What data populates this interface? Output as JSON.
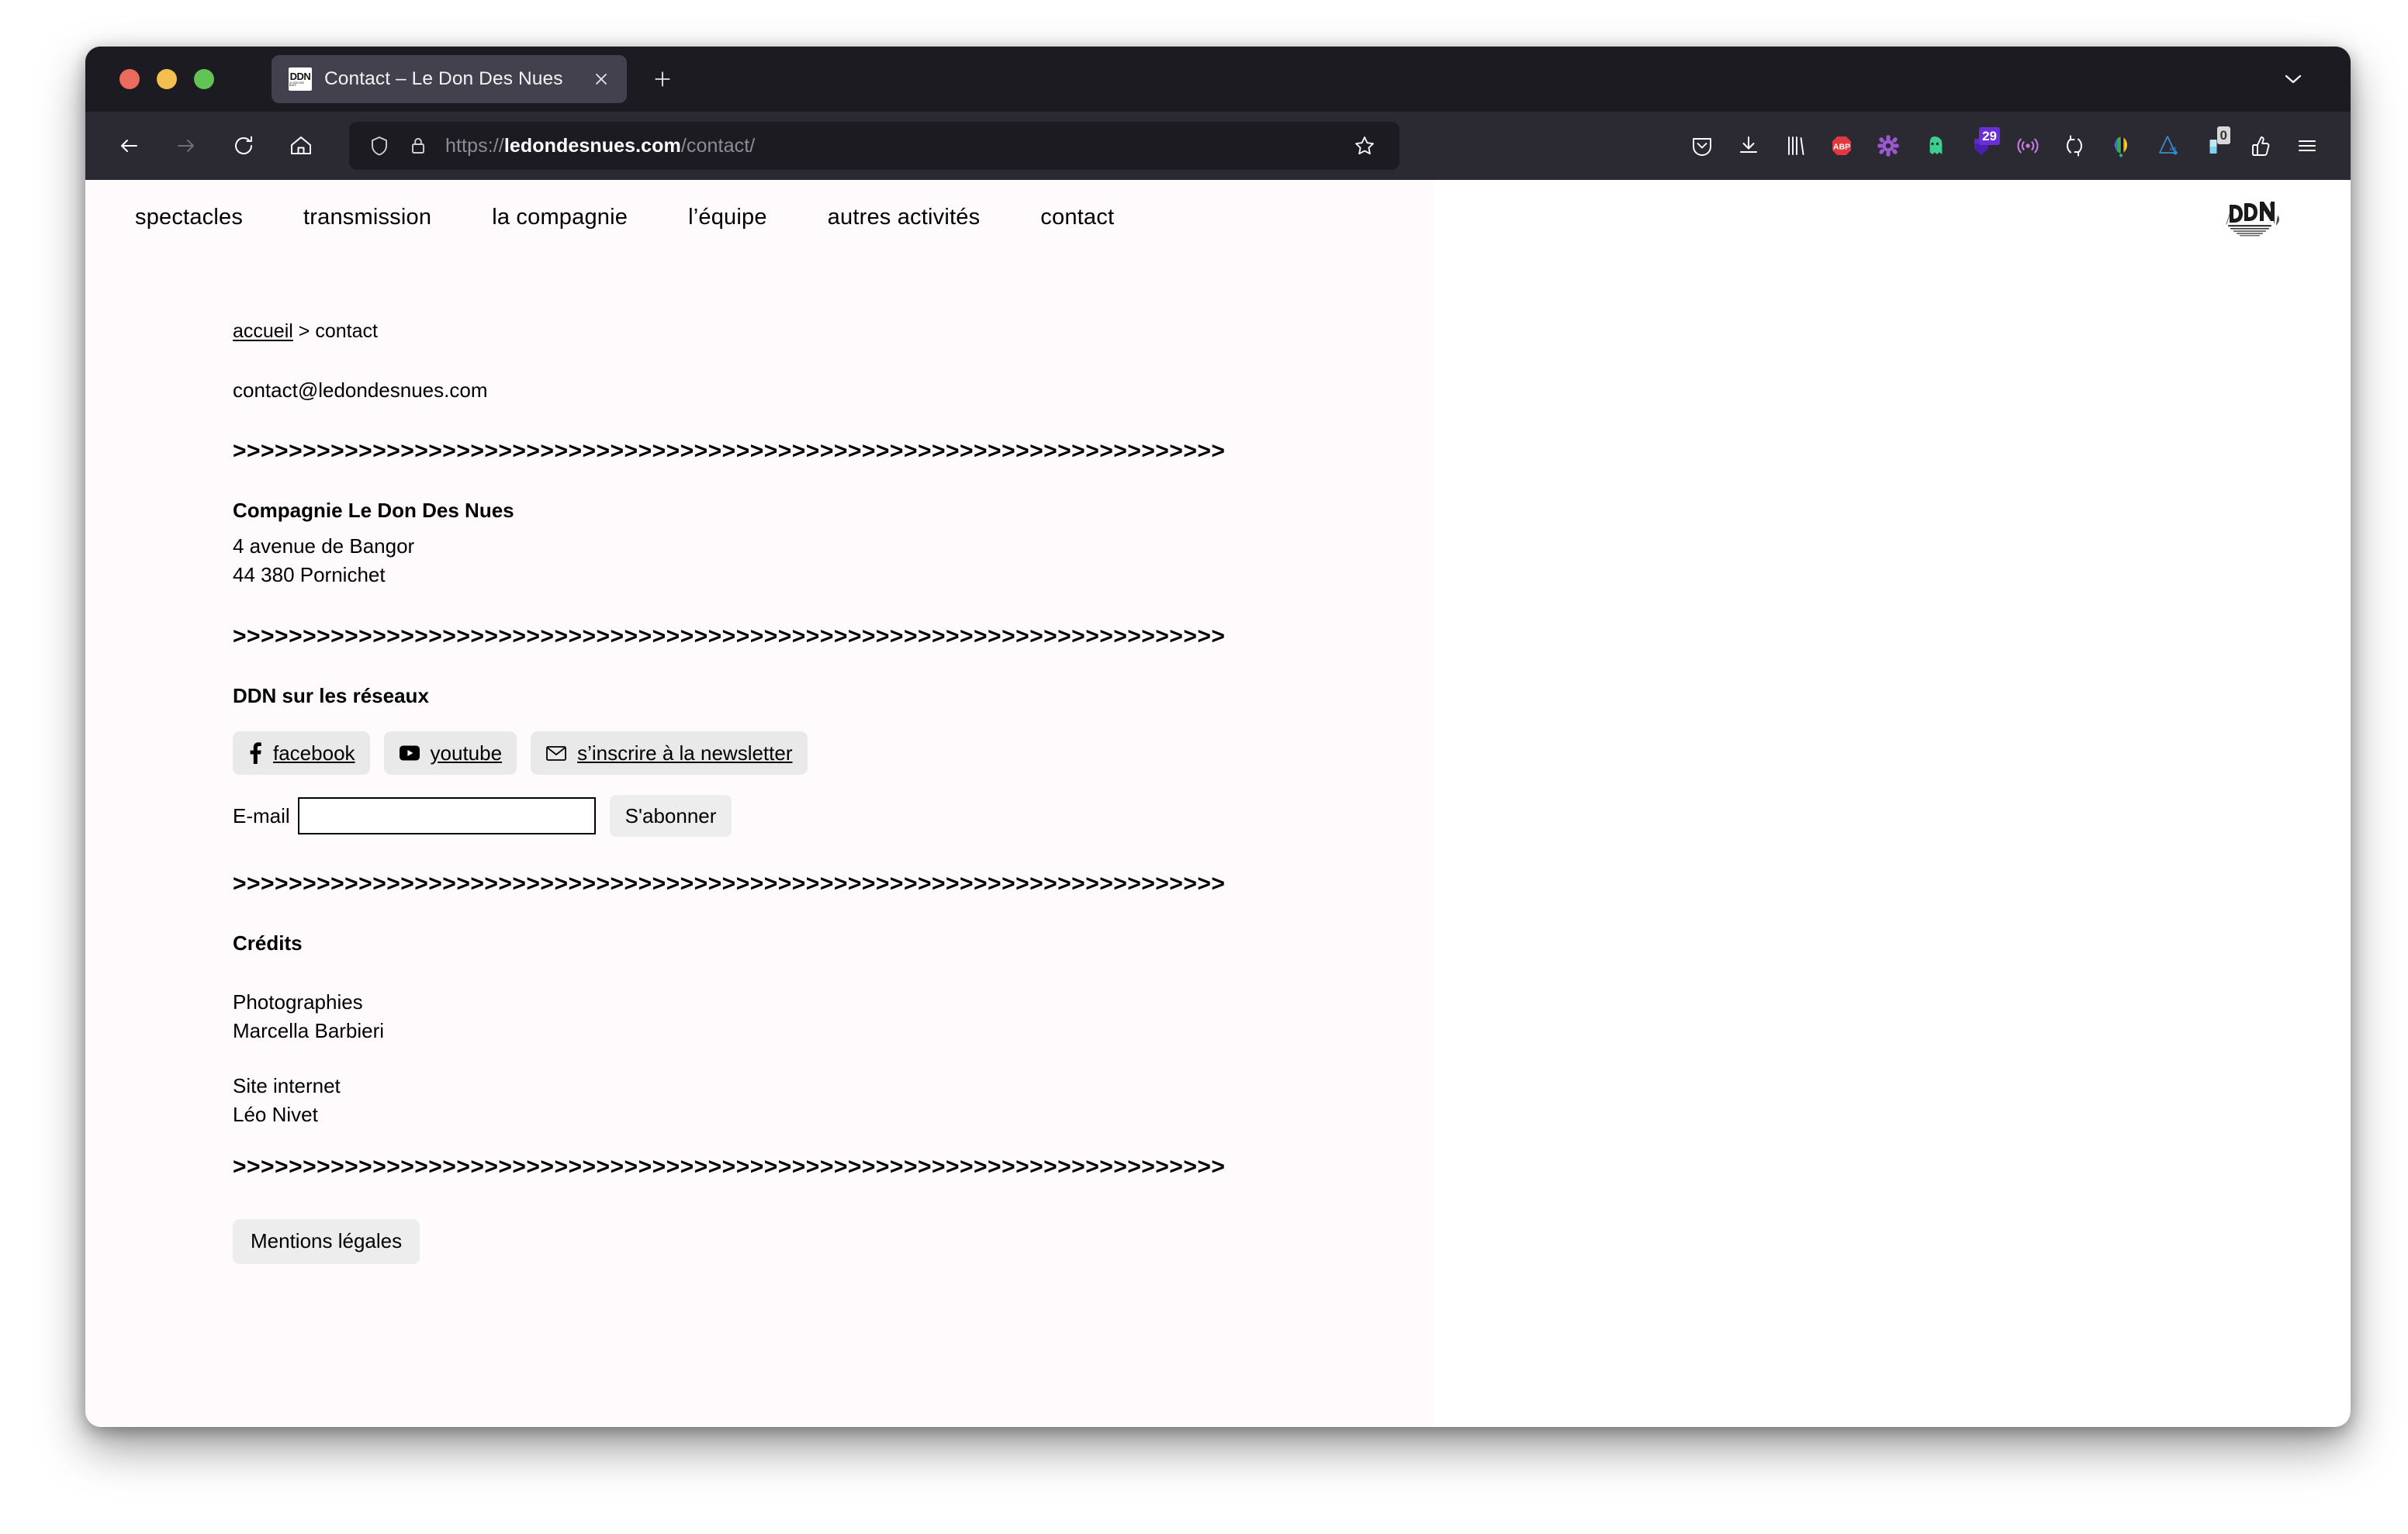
{
  "browser": {
    "traffic_lights": [
      "close",
      "minimize",
      "maximize"
    ],
    "tab": {
      "favicon_text": "DDN",
      "favicon_subtext": "LE DON DES NUES",
      "title": "Contact – Le Don Des Nues",
      "close_icon": "close-icon"
    },
    "new_tab_icon": "plus-icon",
    "tab_list_icon": "chevron-down-icon",
    "nav": {
      "back_icon": "arrow-left-icon",
      "forward_icon": "arrow-right-icon",
      "reload_icon": "reload-icon",
      "home_icon": "home-icon"
    },
    "url": {
      "shield_icon": "shield-icon",
      "lock_icon": "lock-icon",
      "scheme": "https://",
      "host": "ledondesnues.com",
      "path": "/contact/",
      "bookmark_icon": "star-icon"
    },
    "extensions": [
      {
        "name": "pocket-icon",
        "label": "Pocket",
        "color": "#ffffff"
      },
      {
        "name": "download-icon",
        "label": "Téléchargements",
        "color": "#ffffff"
      },
      {
        "name": "library-icon",
        "label": "Bibliothèque",
        "color": "#ffffff"
      },
      {
        "name": "adblock-plus-icon",
        "label": "ABP",
        "color": "#e2383f"
      },
      {
        "name": "gear-purple-icon",
        "label": "Paramètres",
        "color": "#9b59d0"
      },
      {
        "name": "ghostery-icon",
        "label": "Ghostery",
        "color": "#3ecf8e"
      },
      {
        "name": "badge-counter-icon",
        "label": "29",
        "color": "#4b1fb0",
        "badge": "29",
        "badge_color": "#6a2fd6"
      },
      {
        "name": "signal-icon",
        "label": "Signal",
        "color": "#c77de0"
      },
      {
        "name": "sync-icon",
        "label": "Sync",
        "color": "#ffffff"
      },
      {
        "name": "colorwheel-icon",
        "label": "Color Picker",
        "color": "#ffffff"
      },
      {
        "name": "alpha-triangle-icon",
        "label": "αx",
        "color": "#3a8fd4"
      },
      {
        "name": "clipboard-badge-icon",
        "label": "0",
        "color": "#7fd3ef",
        "badge": "0",
        "badge_color": "#d8d8d8"
      },
      {
        "name": "thumbs-up-icon",
        "label": "Thumb",
        "color": "#ffffff"
      },
      {
        "name": "hamburger-menu-icon",
        "label": "Menu",
        "color": "#ffffff"
      }
    ]
  },
  "site": {
    "nav_items": [
      {
        "label": "spectacles"
      },
      {
        "label": "transmission"
      },
      {
        "label": "la compagnie"
      },
      {
        "label": "l’équipe"
      },
      {
        "label": "autres activités"
      },
      {
        "label": "contact"
      }
    ],
    "logo_alt": "DDN Le Don Des Nues"
  },
  "page": {
    "breadcrumb": {
      "home_label": "accueil",
      "separator": " > ",
      "current_label": "contact"
    },
    "email": "contact@ledondesnues.com",
    "divider": ">>>>>>>>>>>>>>>>>>>>>>>>>>>>>>>>>>>>>>>>>>>>>>>>>>>>>>>>>>>>>>>>>>>>>>>",
    "address": {
      "company": "Compagnie Le Don Des Nues",
      "street": "4 avenue de Bangor",
      "city": "44 380 Pornichet"
    },
    "social": {
      "heading": "DDN sur les réseaux",
      "buttons": [
        {
          "icon": "facebook-icon",
          "label": "facebook"
        },
        {
          "icon": "youtube-icon",
          "label": "youtube"
        },
        {
          "icon": "envelope-icon",
          "label": "s’inscrire à la newsletter"
        }
      ]
    },
    "newsletter": {
      "label": "E-mail",
      "value": "",
      "placeholder": "",
      "submit_label": "S'abonner"
    },
    "credits": {
      "heading": "Crédits",
      "groups": [
        {
          "role": "Photographies",
          "name": "Marcella Barbieri"
        },
        {
          "role": "Site internet",
          "name": "Léo Nivet"
        }
      ]
    },
    "legal_button_label": "Mentions légales"
  },
  "colors": {
    "chrome_bg": "#1c1b22",
    "navbar_bg": "#2b2a33",
    "tab_active_bg": "#42414d",
    "urlbar_bg": "#1c1b22",
    "page_bg": "#fffbfc",
    "pill_bg": "#e9e9e9",
    "text": "#000000"
  }
}
